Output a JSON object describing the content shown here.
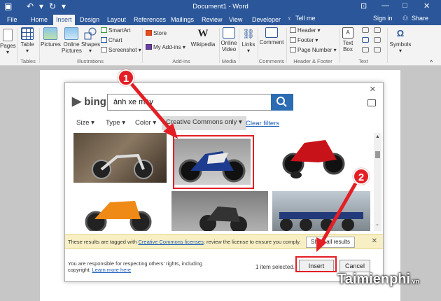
{
  "titlebar": {
    "title": "Document1 - Word",
    "sign_in": "Sign in",
    "share": "Share"
  },
  "tabs": [
    {
      "label": "File"
    },
    {
      "label": "Home"
    },
    {
      "label": "Insert",
      "active": true
    },
    {
      "label": "Design"
    },
    {
      "label": "Layout"
    },
    {
      "label": "References"
    },
    {
      "label": "Mailings"
    },
    {
      "label": "Review"
    },
    {
      "label": "View"
    },
    {
      "label": "Developer"
    }
  ],
  "tell_me": "Tell me",
  "ribbon": {
    "pages": "Pages",
    "table": "Table",
    "tables_group": "Tables",
    "pictures": "Pictures",
    "online_pictures_1": "Online",
    "online_pictures_2": "Pictures",
    "shapes": "Shapes",
    "smartart": "SmartArt",
    "chart": "Chart",
    "screenshot": "Screenshot",
    "illustrations_group": "Illustrations",
    "store": "Store",
    "my_addins": "My Add-ins",
    "wikipedia": "Wikipedia",
    "addins_group": "Add-ins",
    "online_video_1": "Online",
    "online_video_2": "Video",
    "media_group": "Media",
    "links": "Links",
    "comment": "Comment",
    "comments_group": "Comments",
    "header": "Header",
    "footer": "Footer",
    "page_number": "Page Number",
    "header_footer_group": "Header & Footer",
    "text_box_1": "Text",
    "text_box_2": "Box",
    "text_group": "Text",
    "symbols": "Symbols"
  },
  "dialog": {
    "bing_label": "bing",
    "search_value": "ảnh xe máy",
    "filters": {
      "size": "Size",
      "type": "Type",
      "color": "Color",
      "license": "Creative Commons only",
      "clear": "Clear filters"
    },
    "notice_prefix": "These results are tagged with ",
    "notice_link": "Creative Commons licenses",
    "notice_suffix": "; review the license to ensure you comply.",
    "show_all": "Show all results",
    "footer_line1": "You are responsible for respecting others' rights, including",
    "footer_line2": "copyright. ",
    "learn_more": "Learn more here",
    "selected_count": "1 item selected.",
    "insert": "Insert",
    "cancel": "Cancel"
  },
  "annotations": {
    "step1": "1",
    "step2": "2",
    "accent": "#e31e24"
  },
  "watermark": {
    "brand": "Taimienphi",
    "tld": ".vn"
  },
  "colors": {
    "word_blue": "#2b579a",
    "link_blue": "#1a5bb7",
    "notice_yellow": "#f8f0c4"
  }
}
